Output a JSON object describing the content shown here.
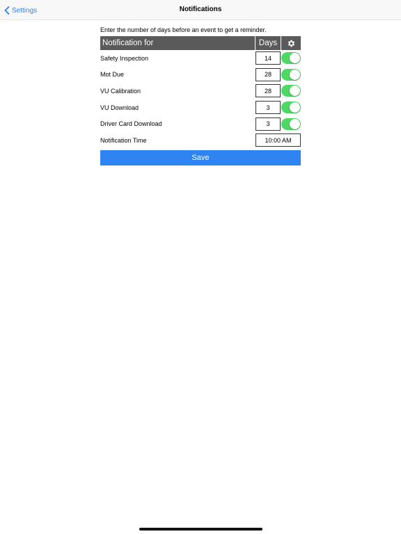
{
  "navbar": {
    "back_label": "Settings",
    "title": "Notifications"
  },
  "instruction": "Enter the number of days before an event to get a reminder.",
  "table": {
    "header_label": "Notification for",
    "header_days": "Days",
    "header_icon": "gear-icon",
    "rows": [
      {
        "label": "Safety Inspection",
        "days": "14",
        "enabled": true
      },
      {
        "label": "Mot Due",
        "days": "28",
        "enabled": true
      },
      {
        "label": "VU Calibration",
        "days": "28",
        "enabled": true
      },
      {
        "label": "VU Download",
        "days": "3",
        "enabled": true
      },
      {
        "label": "Driver Card Download",
        "days": "3",
        "enabled": true
      }
    ],
    "time_label": "Notification Time",
    "time_value": "10:00 AM"
  },
  "save_label": "Save",
  "colors": {
    "accent": "#2f84f3",
    "toggle_on": "#4cd964",
    "header_bg": "#5a5a5a"
  }
}
